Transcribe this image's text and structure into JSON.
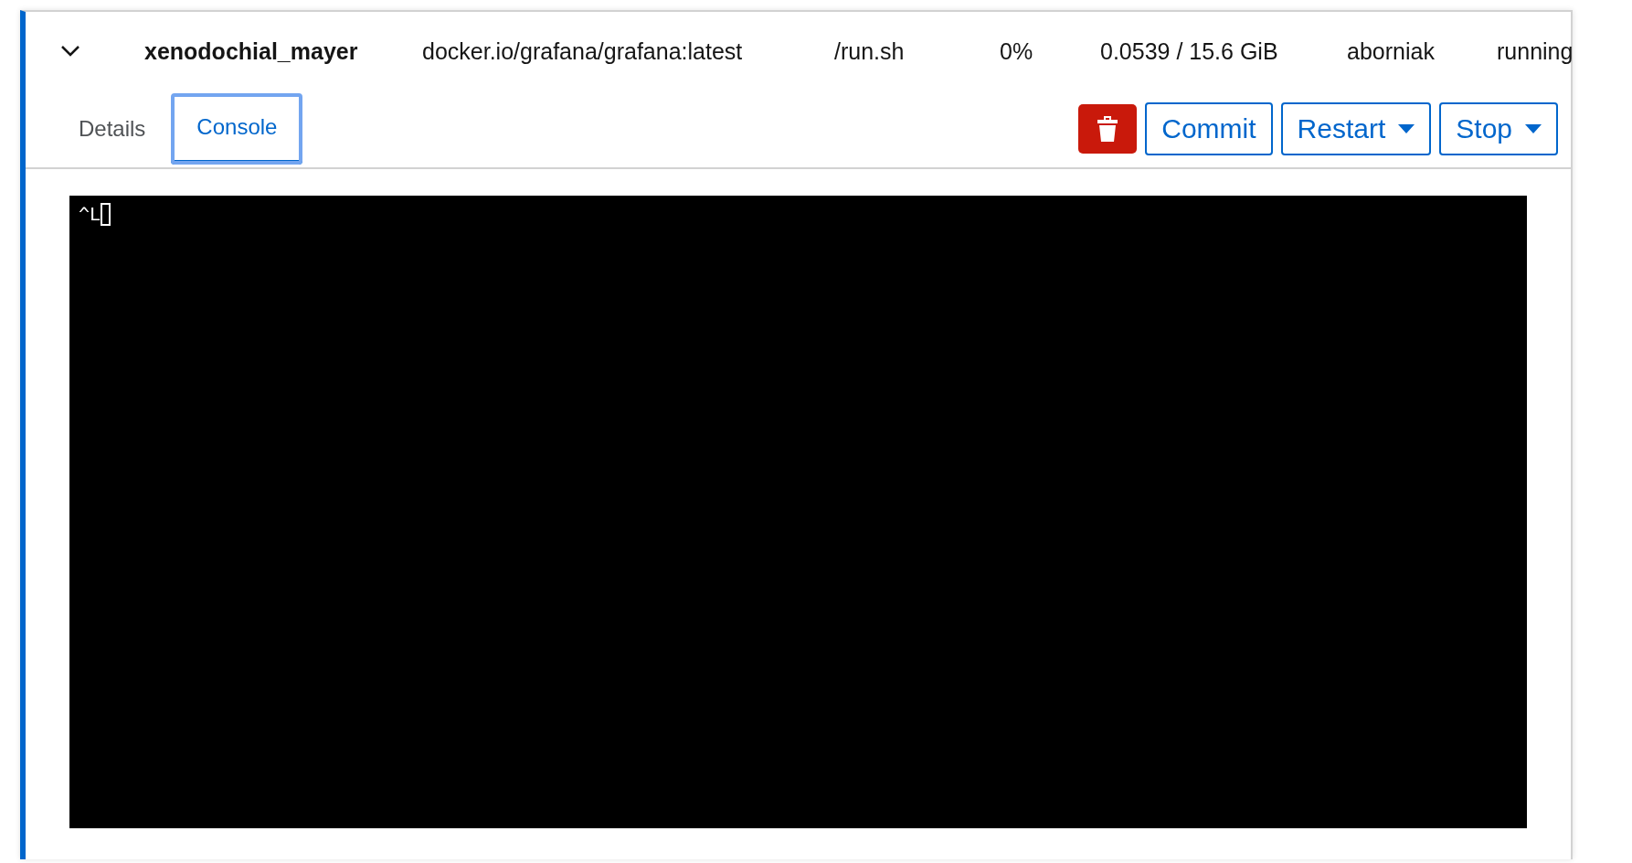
{
  "container": {
    "expanded": true,
    "name": "xenodochial_mayer",
    "image": "docker.io/grafana/grafana:latest",
    "command": "/run.sh",
    "cpu": "0%",
    "memory": "0.0539 / 15.6 GiB",
    "owner": "aborniak",
    "state": "running"
  },
  "tabs": [
    {
      "label": "Details",
      "selected": false
    },
    {
      "label": "Console",
      "selected": true
    }
  ],
  "actions": [
    {
      "kind": "delete"
    },
    {
      "kind": "button",
      "label": "Commit"
    },
    {
      "kind": "dropdown",
      "label": "Restart"
    },
    {
      "kind": "dropdown",
      "label": "Stop"
    }
  ],
  "console": {
    "text": "^L"
  }
}
